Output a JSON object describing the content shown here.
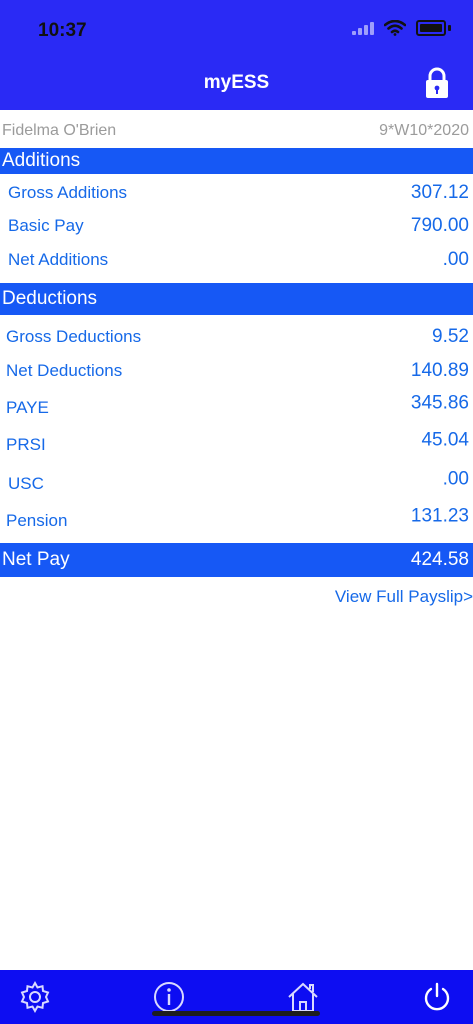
{
  "status_bar": {
    "time": "10:37"
  },
  "header": {
    "title": "myESS",
    "lock_icon": "lock-icon"
  },
  "info": {
    "employee_name": "Fidelma O'Brien",
    "period": "9*W10*2020"
  },
  "additions": {
    "title": "Additions",
    "items": [
      {
        "label": "Gross Additions",
        "value": "307.12"
      },
      {
        "label": "Basic Pay",
        "value": "790.00"
      },
      {
        "label": "Net Additions",
        "value": ".00"
      }
    ]
  },
  "deductions": {
    "title": "Deductions",
    "items": [
      {
        "label": "Gross Deductions",
        "value": "9.52"
      },
      {
        "label": "Net Deductions",
        "value": "140.89"
      },
      {
        "label": "PAYE",
        "value": "345.86"
      },
      {
        "label": "PRSI",
        "value": "45.04"
      },
      {
        "label": "USC",
        "value": ".00"
      },
      {
        "label": "Pension",
        "value": "131.23"
      }
    ]
  },
  "net_pay": {
    "label": "Net Pay",
    "value": "424.58"
  },
  "links": {
    "view_full_payslip": "View Full Payslip>"
  },
  "tab_bar": {
    "icons": [
      "gear-icon",
      "info-icon",
      "home-icon",
      "power-icon"
    ]
  },
  "colors": {
    "header_bg": "#2a2af5",
    "section_bg": "#1658f5",
    "text_blue": "#1669e8",
    "tab_bar_bg": "#0d0df2"
  }
}
